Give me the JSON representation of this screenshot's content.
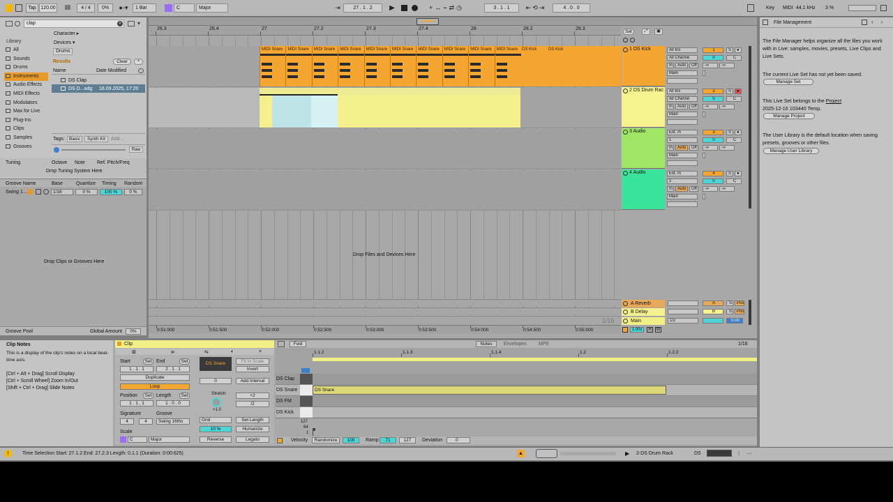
{
  "topbar": {
    "tap": "Tap",
    "tempo": "120.00",
    "signature": "4 / 4",
    "groove_pct": "0%",
    "quantize": "1 Bar",
    "key": "C",
    "scale": "Major",
    "position": "27 .  1 .  2",
    "loop_start": "3 .  1 .  1",
    "loop_length": "4 .  0 .  0",
    "key_label": "Key",
    "midi_label": "MIDI",
    "sample_rate": "44.1 kHz",
    "cpu": "3 %"
  },
  "browser": {
    "search_value": "clap",
    "filters": [
      "Character ▸",
      "Devices ▾",
      "Drums"
    ],
    "results_label": "Results",
    "clear_label": "Clear",
    "library_label": "Library",
    "sidebar": [
      "All",
      "Sounds",
      "Drums",
      "Instruments",
      "Audio Effects",
      "MIDI Effects",
      "Modulators",
      "Max for Live",
      "Plug-Ins",
      "Clips",
      "Samples",
      "Grooves"
    ],
    "col_name": "Name",
    "col_date": "Date Modified",
    "rows": [
      {
        "name": "DS Clap",
        "date": ""
      },
      {
        "name": "DS D...adg",
        "date": "18.09.2025, 17:20"
      }
    ],
    "tags_label": "Tags:",
    "tags": [
      "Basic",
      "Synth Kit",
      "Add..."
    ],
    "raw_label": "Raw"
  },
  "tuning": {
    "title": "Tuning",
    "cols": [
      "Octave",
      "Note",
      "Ref. Pitch/Freq"
    ],
    "drop_text": "Drop Tuning System Here"
  },
  "groove_pool": {
    "cols": [
      "Groove Name",
      "Base",
      "Quantize",
      "Timing",
      "Random"
    ],
    "row": {
      "name": "Swing 1...",
      "base": "1/16",
      "quantize": "0 %",
      "timing": "100 %",
      "random": "0 %"
    },
    "drop_text": "Drop Clips or Grooves Here",
    "footer_label": "Groove Pool",
    "global_amount_label": "Global Amount",
    "global_amount": "0%"
  },
  "arrangement": {
    "bars": [
      "26.3",
      "26.4",
      "27",
      "27.2",
      "27.3",
      "27.4",
      "28",
      "28.2",
      "28.3"
    ],
    "times": [
      "0:51:000",
      "0:51:500",
      "0:52:000",
      "0:52:500",
      "0:53:000",
      "0:53:500",
      "0:54:000",
      "0:54:500",
      "0:55:000"
    ],
    "set_label": "Set",
    "drop_text": "Drop Files and Devices Here",
    "grid_label": "1/16",
    "clip_snare_names": [
      "MIDI Snare",
      "MIDI Snare",
      "MIDI Snare",
      "MIDI Snare",
      "MIDI Snare",
      "MIDI Snare",
      "MIDI Snare",
      "MIDI Snare",
      "MIDI Snare",
      "MIDI Snare"
    ],
    "clip_kick_names": [
      "DS Kick",
      "DS Kick"
    ],
    "tracks": [
      {
        "name": "1 DS Kick",
        "num": "1",
        "input": "All Ins",
        "channel": "All Channe",
        "color": "#f5a631",
        "vol": "0",
        "pan": "C"
      },
      {
        "name": "2 DS Drum Rac",
        "num": "2",
        "input": "All Ins",
        "channel": "All Channe",
        "color": "#f6f38e",
        "vol": "0",
        "pan": "C"
      },
      {
        "name": "3 Audio",
        "num": "3",
        "input": "Ext. In",
        "channel": "1",
        "color": "#9ee664",
        "vol": "0",
        "pan": "C"
      },
      {
        "name": "4 Audio",
        "num": "4",
        "input": "Ext. In",
        "channel": "2",
        "color": "#3be49b",
        "vol": "0",
        "pan": "C"
      }
    ],
    "monitor": [
      "In",
      "Auto",
      "Off"
    ],
    "output": "Main",
    "inf": "-∞",
    "returns": [
      {
        "name": "A Reverb",
        "letter": "A",
        "color": "#e8a85a"
      },
      {
        "name": "B Delay",
        "letter": "B",
        "color": "#f6f38e"
      }
    ],
    "main_name": "Main",
    "main_out": "1/2",
    "post_label": "Post",
    "main_vol": "0.00"
  },
  "right_panel": {
    "title": "File Management",
    "p1": "The File Manager helps organize all the files you work with in Live: samples, movies, presets, Live Clips and Live Sets.",
    "btn1": "Manage Set",
    "p2": "The current Live Set has not yet been saved.",
    "p3_pre": "This Live Set belongs to the ",
    "p3_link": "Project",
    "p3_post": "2025-12-16 103440 Temp.",
    "btn2": "Manage Project",
    "p4": "The User Library is the default location when saving presets, grooves or other files.",
    "btn3": "Manage User Library"
  },
  "clip_notes": {
    "title": "Clip Notes",
    "text1": "This is a display of the clip's notes on a local beat-time axis.",
    "text2": "[Ctrl + Alt + Drag] Scroll Display",
    "text3": "[Ctrl + Scroll Wheel] Zoom In/Out",
    "text4": "[Shift + Ctrl + Drag] Slide Notes"
  },
  "clip": {
    "title": "Clip",
    "start_label": "Start",
    "end_label": "End",
    "set_label": "Set",
    "start": "1 .   1 .   1",
    "end": "2 .   1 .   1",
    "duplicate": "Duplicate",
    "loop": "Loop",
    "position_label": "Position",
    "length_label": "Length",
    "position": "1 .   1 .   1",
    "length": "1 .   0 .   0",
    "signature_label": "Signature",
    "groove_label": "Groove",
    "sig_num": "4",
    "sig_den": "4",
    "groove": "Swing 16ths",
    "scale_label": "Scale",
    "scale_key": "C",
    "scale_name": "Major",
    "clip_name": "DS Snare",
    "transpose": "0",
    "fit_to_scale": "Fit to Scale",
    "invert": "Invert",
    "add_interval": "Add Interval",
    "stretch_label": "Stretch",
    "stretch_val": "×1.0",
    "x2": "×2",
    "div2": "/2",
    "grid": "Grid",
    "set_length": "Set Length",
    "humanize_pct": "10 %",
    "humanize": "Humanize",
    "reverse": "Reverse",
    "legato": "Legato"
  },
  "notes_editor": {
    "fold": "Fold",
    "tabs": [
      "Notes",
      "Envelopes",
      "MPE"
    ],
    "grid": "1/16",
    "ruler": [
      "1.1.2",
      "1.1.3",
      "1.1.4",
      "1.2",
      "1.2.2"
    ],
    "pads": [
      "DS Clap",
      "DS Snare",
      "DS FM",
      "DS Kick"
    ],
    "note_label": "DS Snare",
    "vel_ticks": [
      "127",
      "64",
      "1"
    ],
    "velocity_label": "Velocity",
    "randomize": "Randomize",
    "vel_val": "100",
    "ramp_label": "Ramp",
    "ramp_a": "71",
    "ramp_b": "127",
    "deviation_label": "Deviation",
    "deviation": "0"
  },
  "status": {
    "text": "Time Selection   Start: 27.1.2   End: 27.2.3   Length: 0.1.1  (Duration: 0:00:625)",
    "track": "2-DS Drum Rack",
    "ds": "DS"
  }
}
